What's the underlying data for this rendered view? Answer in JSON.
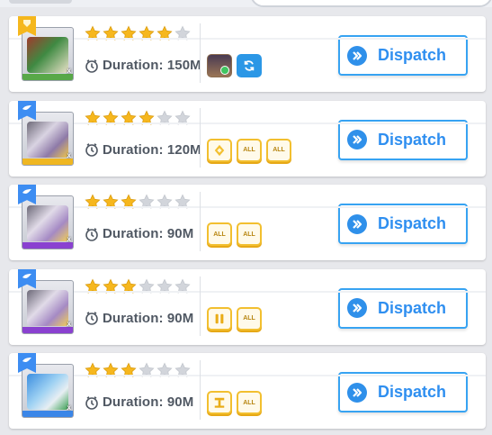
{
  "colors": {
    "accent": "#2f8ff0",
    "star_on": "#f6b71e",
    "star_off": "#d2d5db",
    "tag_border": "#f2bf2f"
  },
  "missions": [
    {
      "ribbon": "gold",
      "rarity": "green",
      "stars_filled": 5,
      "stars_total": 6,
      "duration_label": "Duration: 150M",
      "dispatch_label": "Dispatch",
      "tags": [
        {
          "type": "character",
          "label": ""
        },
        {
          "type": "refresh-icon",
          "label": ""
        }
      ]
    },
    {
      "ribbon": "blue",
      "rarity": "gold",
      "stars_filled": 4,
      "stars_total": 6,
      "duration_label": "Duration: 120M",
      "dispatch_label": "Dispatch",
      "tags": [
        {
          "type": "diamond-icon",
          "label": ""
        },
        {
          "type": "text",
          "label": "ALL"
        },
        {
          "type": "text",
          "label": "ALL"
        }
      ]
    },
    {
      "ribbon": "blue",
      "rarity": "purple",
      "stars_filled": 3,
      "stars_total": 6,
      "duration_label": "Duration: 90M",
      "dispatch_label": "Dispatch",
      "tags": [
        {
          "type": "text",
          "label": "ALL"
        },
        {
          "type": "text",
          "label": "ALL"
        }
      ]
    },
    {
      "ribbon": "blue",
      "rarity": "purple",
      "stars_filled": 3,
      "stars_total": 6,
      "duration_label": "Duration: 90M",
      "dispatch_label": "Dispatch",
      "tags": [
        {
          "type": "bars-icon",
          "label": ""
        },
        {
          "type": "text",
          "label": "ALL"
        }
      ]
    },
    {
      "ribbon": "blue",
      "rarity": "blue",
      "stars_filled": 3,
      "stars_total": 6,
      "duration_label": "Duration: 90M",
      "dispatch_label": "Dispatch",
      "tags": [
        {
          "type": "pillar-icon",
          "label": ""
        },
        {
          "type": "text",
          "label": "ALL"
        }
      ]
    }
  ]
}
